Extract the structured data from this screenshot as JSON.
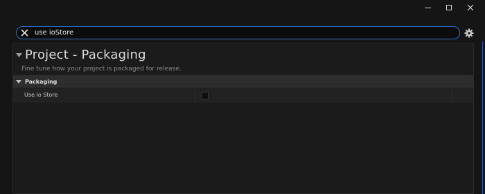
{
  "window": {
    "controls": [
      "minimize",
      "maximize",
      "close"
    ]
  },
  "search": {
    "value": "use ioStore",
    "clear_icon": "close-icon",
    "settings_icon": "gear-icon"
  },
  "section": {
    "title": "Project - Packaging",
    "description": "Fine tune how your project is packaged for release."
  },
  "category": {
    "label": "Packaging"
  },
  "properties": [
    {
      "label": "Use Io Store",
      "checked": false
    }
  ],
  "colors": {
    "accent": "#2f6fd6",
    "background": "#151515",
    "panel": "#1b1b1b",
    "category_bar": "#2e2e2e"
  }
}
